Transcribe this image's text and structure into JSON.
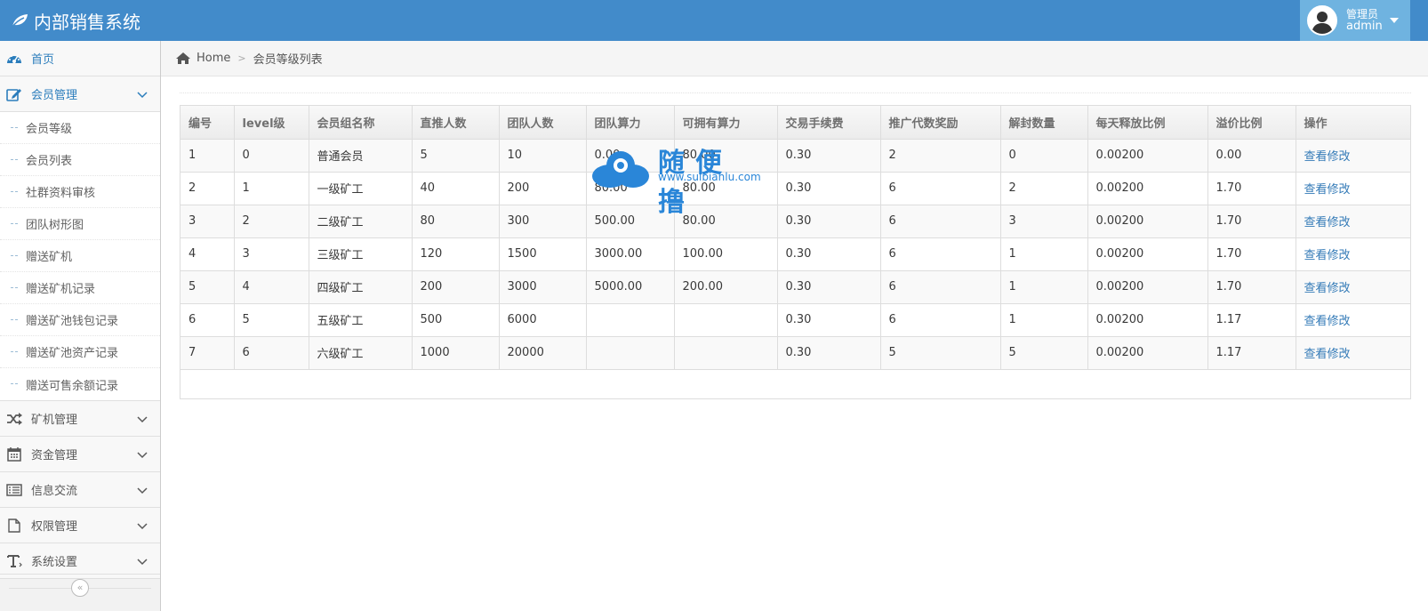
{
  "app": {
    "title": "内部销售系统"
  },
  "user": {
    "role": "管理员",
    "name": "admin"
  },
  "sidebar": {
    "items": [
      {
        "label": "首页",
        "icon": "dashboard-icon",
        "active": true
      },
      {
        "label": "会员管理",
        "icon": "edit-icon",
        "expanded": true,
        "children": [
          "会员等级",
          "会员列表",
          "社群资料审核",
          "团队树形图",
          "赠送矿机",
          "赠送矿机记录",
          "赠送矿池钱包记录",
          "赠送矿池资产记录",
          "赠送可售余额记录"
        ]
      },
      {
        "label": "矿机管理",
        "icon": "shuffle-icon"
      },
      {
        "label": "资金管理",
        "icon": "calendar-icon"
      },
      {
        "label": "信息交流",
        "icon": "list-icon"
      },
      {
        "label": "权限管理",
        "icon": "file-icon"
      },
      {
        "label": "系统设置",
        "icon": "text-icon"
      }
    ],
    "collapse_glyph": "«"
  },
  "breadcrumb": {
    "home": "Home",
    "separator": ">",
    "current": "会员等级列表"
  },
  "table": {
    "headers": [
      "编号",
      "level级",
      "会员组名称",
      "直推人数",
      "团队人数",
      "团队算力",
      "可拥有算力",
      "交易手续费",
      "推广代数奖励",
      "解封数量",
      "每天释放比例",
      "溢价比例",
      "操作"
    ],
    "rows": [
      [
        "1",
        "0",
        "普通会员",
        "5",
        "10",
        "0.00",
        "80.00",
        "0.30",
        "2",
        "0",
        "0.00200",
        "0.00",
        "查看修改"
      ],
      [
        "2",
        "1",
        "一级矿工",
        "40",
        "200",
        "80.00",
        "80.00",
        "0.30",
        "6",
        "2",
        "0.00200",
        "1.70",
        "查看修改"
      ],
      [
        "3",
        "2",
        "二级矿工",
        "80",
        "300",
        "500.00",
        "80.00",
        "0.30",
        "6",
        "3",
        "0.00200",
        "1.70",
        "查看修改"
      ],
      [
        "4",
        "3",
        "三级矿工",
        "120",
        "1500",
        "3000.00",
        "100.00",
        "0.30",
        "6",
        "1",
        "0.00200",
        "1.70",
        "查看修改"
      ],
      [
        "5",
        "4",
        "四级矿工",
        "200",
        "3000",
        "5000.00",
        "200.00",
        "0.30",
        "6",
        "1",
        "0.00200",
        "1.70",
        "查看修改"
      ],
      [
        "6",
        "5",
        "五级矿工",
        "500",
        "6000",
        "",
        "",
        "0.30",
        "6",
        "1",
        "0.00200",
        "1.17",
        "查看修改"
      ],
      [
        "7",
        "6",
        "六级矿工",
        "1000",
        "20000",
        "",
        "",
        "0.30",
        "5",
        "5",
        "0.00200",
        "1.17",
        "查看修改"
      ]
    ]
  },
  "watermark": {
    "title": "随便撸",
    "url": "www.suibianlu.com"
  },
  "colors": {
    "header": "#428bca",
    "user_box": "#6fb3e0",
    "link": "#337ab7",
    "active": "#2b7dbc"
  }
}
